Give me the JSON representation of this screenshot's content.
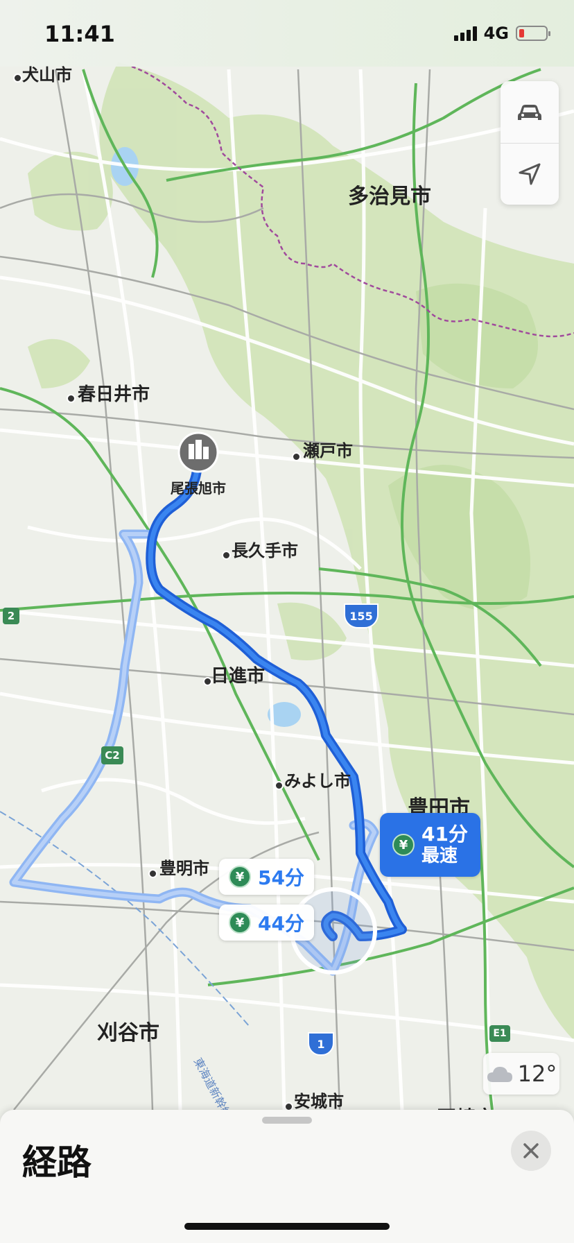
{
  "status_bar": {
    "time": "11:41",
    "network": "4G"
  },
  "map": {
    "city_labels": [
      {
        "text": "犬山市"
      },
      {
        "text": "多治見市"
      },
      {
        "text": "春日井市"
      },
      {
        "text": "瀬戸市"
      },
      {
        "text": "尾張旭市"
      },
      {
        "text": "長久手市"
      },
      {
        "text": "日進市"
      },
      {
        "text": "みよし市"
      },
      {
        "text": "豊田市"
      },
      {
        "text": "豊明市"
      },
      {
        "text": "刈谷市"
      },
      {
        "text": "安城市"
      },
      {
        "text": "岡崎市"
      }
    ],
    "road_shields": [
      "2",
      "155",
      "C2",
      "1",
      "E1"
    ],
    "rail_label": "東海道新幹線",
    "destination_icon": "building-marker-icon"
  },
  "routes": {
    "fastest": {
      "time": "41分",
      "tag": "最速",
      "toll_symbol": "¥"
    },
    "alt1": {
      "time": "54分",
      "toll_symbol": "¥"
    },
    "alt2": {
      "time": "44分",
      "toll_symbol": "¥"
    }
  },
  "controls": {
    "top_icon": "car-icon",
    "bottom_icon": "location-arrow-icon"
  },
  "weather": {
    "temp": "12°",
    "icon": "cloud-icon"
  },
  "sheet": {
    "title": "経路",
    "close_icon": "close-icon"
  },
  "colors": {
    "route_primary": "#2a72e6",
    "route_alt": "#8fb6f3",
    "toll_green": "#2e8b57"
  }
}
